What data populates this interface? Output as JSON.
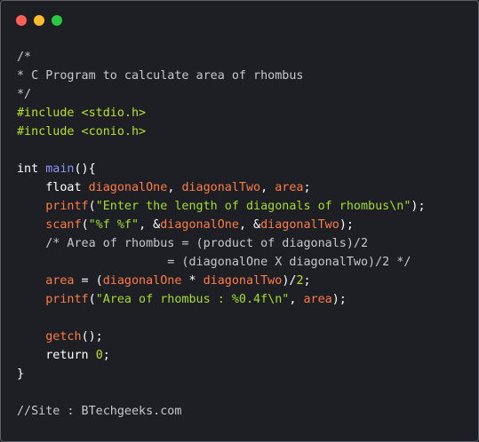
{
  "window": {
    "controls": [
      {
        "name": "close",
        "color": "#ff5f57"
      },
      {
        "name": "minimize",
        "color": "#febc2e"
      },
      {
        "name": "maximize",
        "color": "#28c840"
      }
    ]
  },
  "colors": {
    "background": "#1e1f25",
    "comment": "#c6c8cc",
    "preprocessor": "#b7e327",
    "keyword": "#ffffff",
    "function_name": "#8d93f0",
    "variable": "#ff7b45",
    "string": "#a4db2f",
    "number": "#b7e327"
  },
  "code": {
    "lines": [
      [
        {
          "t": "/*",
          "c": "comment"
        }
      ],
      [
        {
          "t": "* C Program to calculate area of rhombus",
          "c": "comment"
        }
      ],
      [
        {
          "t": "*/",
          "c": "comment"
        }
      ],
      [
        {
          "t": "#include <stdio.h>",
          "c": "pre"
        }
      ],
      [
        {
          "t": "#include <conio.h>",
          "c": "pre"
        }
      ],
      [],
      [
        {
          "t": "int ",
          "c": "kw"
        },
        {
          "t": "main",
          "c": "fn"
        },
        {
          "t": "(){",
          "c": "plain"
        }
      ],
      [
        {
          "t": "    float ",
          "c": "kw"
        },
        {
          "t": "diagonalOne",
          "c": "var"
        },
        {
          "t": ", ",
          "c": "plain"
        },
        {
          "t": "diagonalTwo",
          "c": "var"
        },
        {
          "t": ", ",
          "c": "plain"
        },
        {
          "t": "area",
          "c": "var"
        },
        {
          "t": ";",
          "c": "plain"
        }
      ],
      [
        {
          "t": "    ",
          "c": "plain"
        },
        {
          "t": "printf",
          "c": "call"
        },
        {
          "t": "(",
          "c": "plain"
        },
        {
          "t": "\"Enter the length of diagonals of rhombus\\n\"",
          "c": "str"
        },
        {
          "t": ");",
          "c": "plain"
        }
      ],
      [
        {
          "t": "    ",
          "c": "plain"
        },
        {
          "t": "scanf",
          "c": "call"
        },
        {
          "t": "(",
          "c": "plain"
        },
        {
          "t": "\"%f %f\"",
          "c": "str"
        },
        {
          "t": ", &",
          "c": "plain"
        },
        {
          "t": "diagonalOne",
          "c": "var"
        },
        {
          "t": ", &",
          "c": "plain"
        },
        {
          "t": "diagonalTwo",
          "c": "var"
        },
        {
          "t": ");",
          "c": "plain"
        }
      ],
      [
        {
          "t": "    /* Area of rhombus = (product of diagonals)/2",
          "c": "comment"
        }
      ],
      [
        {
          "t": "                     = (diagonalOne X diagonalTwo)/2 */",
          "c": "comment"
        }
      ],
      [
        {
          "t": "    ",
          "c": "plain"
        },
        {
          "t": "area",
          "c": "var"
        },
        {
          "t": " = (",
          "c": "plain"
        },
        {
          "t": "diagonalOne",
          "c": "var"
        },
        {
          "t": " * ",
          "c": "plain"
        },
        {
          "t": "diagonalTwo",
          "c": "var"
        },
        {
          "t": ")/",
          "c": "plain"
        },
        {
          "t": "2",
          "c": "num"
        },
        {
          "t": ";",
          "c": "plain"
        }
      ],
      [
        {
          "t": "    ",
          "c": "plain"
        },
        {
          "t": "printf",
          "c": "call"
        },
        {
          "t": "(",
          "c": "plain"
        },
        {
          "t": "\"Area of rhombus : %0.4f\\n\"",
          "c": "str"
        },
        {
          "t": ", ",
          "c": "plain"
        },
        {
          "t": "area",
          "c": "var"
        },
        {
          "t": ");",
          "c": "plain"
        }
      ],
      [],
      [
        {
          "t": "    ",
          "c": "plain"
        },
        {
          "t": "getch",
          "c": "call"
        },
        {
          "t": "();",
          "c": "plain"
        }
      ],
      [
        {
          "t": "    return ",
          "c": "kw"
        },
        {
          "t": "0",
          "c": "num"
        },
        {
          "t": ";",
          "c": "plain"
        }
      ],
      [
        {
          "t": "}",
          "c": "plain"
        }
      ],
      [],
      [
        {
          "t": "//Site : BTechgeeks.com",
          "c": "comment"
        }
      ]
    ]
  }
}
